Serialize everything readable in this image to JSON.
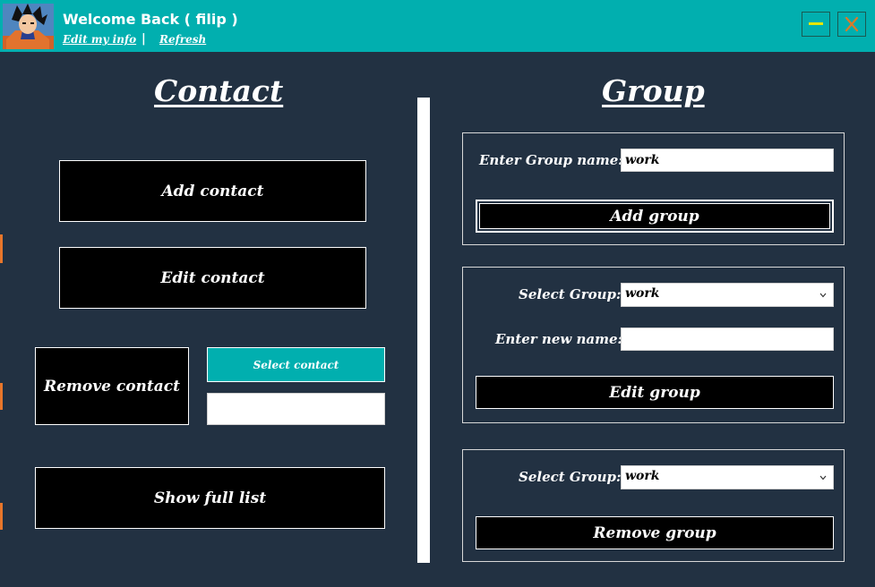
{
  "header": {
    "welcome": "Welcome Back ( filip )",
    "edit_info": "Edit my info",
    "separator": "|",
    "refresh": "Refresh",
    "minimize_icon": "minimize-icon",
    "close_icon": "close-icon"
  },
  "contact": {
    "title": "Contact",
    "add": "Add contact",
    "edit": "Edit contact",
    "remove": "Remove contact",
    "select": "Select contact",
    "selected_value": "",
    "show_full": "Show full list"
  },
  "group": {
    "title": "Group",
    "add_panel": {
      "label": "Enter Group name:",
      "value": "work",
      "button": "Add group"
    },
    "edit_panel": {
      "select_label": "Select Group:",
      "select_value": "work",
      "newname_label": "Enter new name:",
      "newname_value": "",
      "button": "Edit group"
    },
    "remove_panel": {
      "select_label": "Select Group:",
      "select_value": "work",
      "button": "Remove group"
    }
  },
  "colors": {
    "background": "#223142",
    "accent": "#01afaf",
    "button": "#000000",
    "minimize_icon": "#e6e600",
    "close_icon": "#d97a2a"
  }
}
